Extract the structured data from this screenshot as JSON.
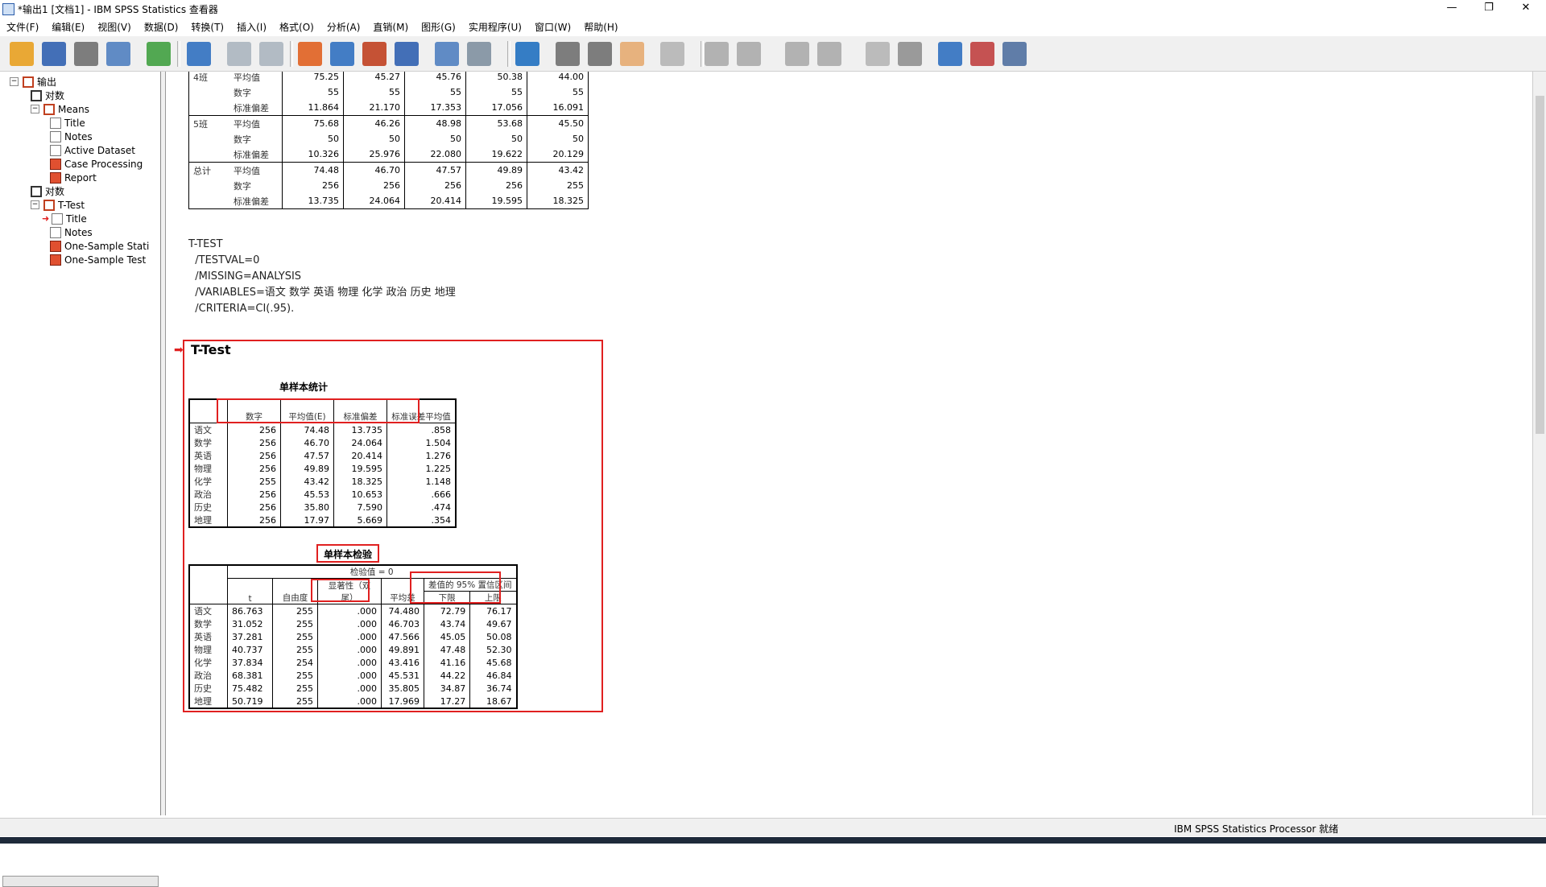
{
  "window": {
    "title": "*输出1 [文档1] - IBM SPSS Statistics 查看器",
    "minimize": "—",
    "restore": "❐",
    "close": "✕"
  },
  "menu": [
    "文件(F)",
    "编辑(E)",
    "视图(V)",
    "数据(D)",
    "转换(T)",
    "插入(I)",
    "格式(O)",
    "分析(A)",
    "直销(M)",
    "图形(G)",
    "实用程序(U)",
    "窗口(W)",
    "帮助(H)"
  ],
  "toolbar_icons": [
    "open-icon",
    "save-icon",
    "print-icon",
    "print-preview-icon",
    "export-icon",
    "recall-dialog-icon",
    "undo-icon",
    "redo-icon",
    "goto-case-icon",
    "goto-variable-icon",
    "insert-cases-icon",
    "variables-icon",
    "select-cases-icon",
    "weight-cases-icon",
    "split-file-icon",
    "promote-icon",
    "demote-icon",
    "show-hide-icon",
    "collapse-icon",
    "previous-icon",
    "next-icon",
    "expand-icon",
    "collapse-all-icon",
    "insert-heading-icon",
    "insert-title-icon",
    "insert-text-icon",
    "insert-chart-icon",
    "designate-window-icon",
    "pivot-icon"
  ],
  "tree": {
    "items": [
      {
        "label": "输出",
        "depth": 0,
        "icon": "output-book-icon",
        "expander": "−"
      },
      {
        "label": "对数",
        "depth": 1,
        "icon": "log-icon"
      },
      {
        "label": "Means",
        "depth": 1,
        "icon": "procedure-book-icon",
        "expander": "−"
      },
      {
        "label": "Title",
        "depth": 2,
        "icon": "title-doc-icon"
      },
      {
        "label": "Notes",
        "depth": 2,
        "icon": "notes-icon"
      },
      {
        "label": "Active Dataset",
        "depth": 2,
        "icon": "dataset-doc-icon"
      },
      {
        "label": "Case Processing",
        "depth": 2,
        "icon": "table-icon"
      },
      {
        "label": "Report",
        "depth": 2,
        "icon": "table-icon"
      },
      {
        "label": "对数",
        "depth": 1,
        "icon": "log-icon"
      },
      {
        "label": "T-Test",
        "depth": 1,
        "icon": "procedure-book-icon",
        "expander": "−"
      },
      {
        "label": "Title",
        "depth": 2,
        "icon": "title-doc-icon",
        "current": true
      },
      {
        "label": "Notes",
        "depth": 2,
        "icon": "notes-icon"
      },
      {
        "label": "One-Sample Stati",
        "depth": 2,
        "icon": "table-icon"
      },
      {
        "label": "One-Sample Test",
        "depth": 2,
        "icon": "table-icon"
      }
    ]
  },
  "report_table": {
    "rows": [
      {
        "group": "4班",
        "stat": "平均值",
        "values": [
          "75.25",
          "45.27",
          "45.76",
          "50.38",
          "44.00"
        ]
      },
      {
        "group": "",
        "stat": "数字",
        "values": [
          "55",
          "55",
          "55",
          "55",
          "55"
        ]
      },
      {
        "group": "",
        "stat": "标准偏差",
        "values": [
          "11.864",
          "21.170",
          "17.353",
          "17.056",
          "16.091"
        ]
      },
      {
        "group": "5班",
        "stat": "平均值",
        "values": [
          "75.68",
          "46.26",
          "48.98",
          "53.68",
          "45.50"
        ]
      },
      {
        "group": "",
        "stat": "数字",
        "values": [
          "50",
          "50",
          "50",
          "50",
          "50"
        ]
      },
      {
        "group": "",
        "stat": "标准偏差",
        "values": [
          "10.326",
          "25.976",
          "22.080",
          "19.622",
          "20.129"
        ]
      },
      {
        "group": "总计",
        "stat": "平均值",
        "values": [
          "74.48",
          "46.70",
          "47.57",
          "49.89",
          "43.42"
        ]
      },
      {
        "group": "",
        "stat": "数字",
        "values": [
          "256",
          "256",
          "256",
          "256",
          "255"
        ]
      },
      {
        "group": "",
        "stat": "标准偏差",
        "values": [
          "13.735",
          "24.064",
          "20.414",
          "19.595",
          "18.325"
        ]
      }
    ]
  },
  "syntax": [
    "T-TEST",
    "  /TESTVAL=0",
    "  /MISSING=ANALYSIS",
    "  /VARIABLES=语文 数学 英语 物理 化学 政治 历史 地理",
    "  /CRITERIA=CI(.95)."
  ],
  "ttest_heading": "T-Test",
  "stats_table": {
    "title": "单样本统计",
    "headers": [
      "数字",
      "平均值(E)",
      "标准偏差",
      "标准误差平均值"
    ],
    "rows": [
      {
        "label": "语文",
        "values": [
          "256",
          "74.48",
          "13.735",
          ".858"
        ]
      },
      {
        "label": "数学",
        "values": [
          "256",
          "46.70",
          "24.064",
          "1.504"
        ]
      },
      {
        "label": "英语",
        "values": [
          "256",
          "47.57",
          "20.414",
          "1.276"
        ]
      },
      {
        "label": "物理",
        "values": [
          "256",
          "49.89",
          "19.595",
          "1.225"
        ]
      },
      {
        "label": "化学",
        "values": [
          "255",
          "43.42",
          "18.325",
          "1.148"
        ]
      },
      {
        "label": "政治",
        "values": [
          "256",
          "45.53",
          "10.653",
          ".666"
        ]
      },
      {
        "label": "历史",
        "values": [
          "256",
          "35.80",
          "7.590",
          ".474"
        ]
      },
      {
        "label": "地理",
        "values": [
          "256",
          "17.97",
          "5.669",
          ".354"
        ]
      }
    ]
  },
  "test_table": {
    "title": "单样本检验",
    "test_value": "检验值 = 0",
    "headers": [
      "t",
      "自由度",
      "显著性（双尾）",
      "平均差"
    ],
    "ci_header": "差值的 95% 置信区间",
    "ci_sub": [
      "下限",
      "上限"
    ],
    "rows": [
      {
        "label": "语文",
        "values": [
          "86.763",
          "255",
          ".000",
          "74.480",
          "72.79",
          "76.17"
        ]
      },
      {
        "label": "数学",
        "values": [
          "31.052",
          "255",
          ".000",
          "46.703",
          "43.74",
          "49.67"
        ]
      },
      {
        "label": "英语",
        "values": [
          "37.281",
          "255",
          ".000",
          "47.566",
          "45.05",
          "50.08"
        ]
      },
      {
        "label": "物理",
        "values": [
          "40.737",
          "255",
          ".000",
          "49.891",
          "47.48",
          "52.30"
        ]
      },
      {
        "label": "化学",
        "values": [
          "37.834",
          "254",
          ".000",
          "43.416",
          "41.16",
          "45.68"
        ]
      },
      {
        "label": "政治",
        "values": [
          "68.381",
          "255",
          ".000",
          "45.531",
          "44.22",
          "46.84"
        ]
      },
      {
        "label": "历史",
        "values": [
          "75.482",
          "255",
          ".000",
          "35.805",
          "34.87",
          "36.74"
        ]
      },
      {
        "label": "地理",
        "values": [
          "50.719",
          "255",
          ".000",
          "17.969",
          "17.27",
          "18.67"
        ]
      }
    ]
  },
  "status": {
    "text": "IBM SPSS Statistics Processor 就绪"
  },
  "colors": {
    "highlight_box": "#e02020",
    "toolbar_bg": "#f0f0f0"
  }
}
